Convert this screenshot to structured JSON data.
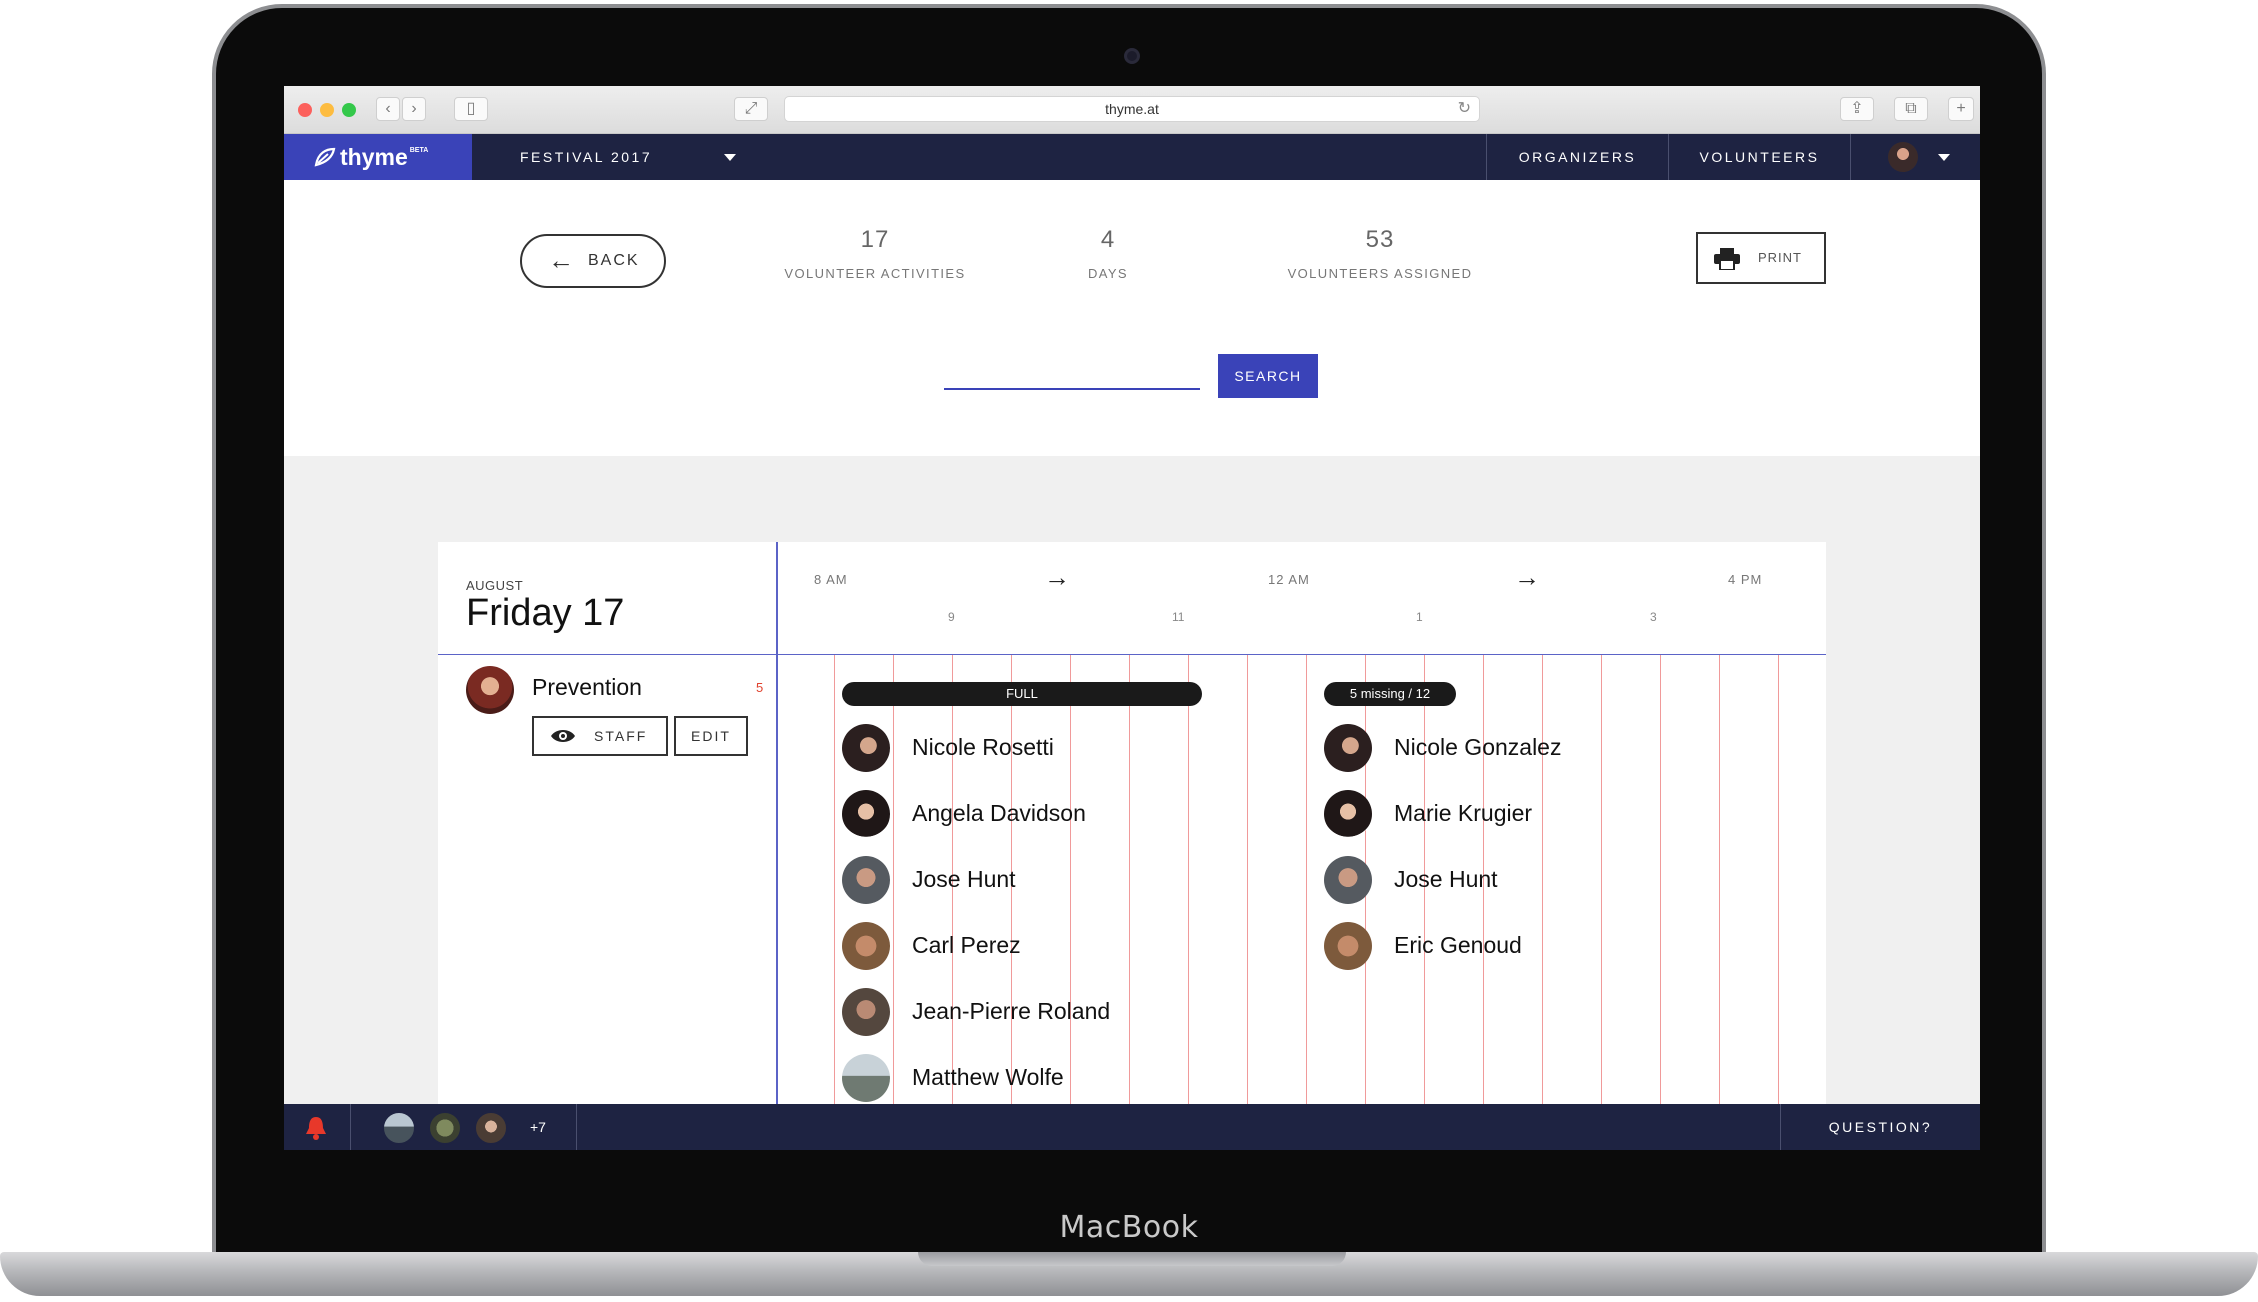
{
  "device": {
    "label": "MacBook"
  },
  "browser": {
    "url": "thyme.at"
  },
  "nav": {
    "brand": "thyme",
    "brand_badge": "BETA",
    "event": "FESTIVAL 2017",
    "links": [
      "ORGANIZERS",
      "VOLUNTEERS"
    ],
    "accent": "#3a43b8",
    "bar_color": "#1e2342"
  },
  "header": {
    "back_label": "BACK",
    "stats": [
      {
        "value": "17",
        "label": "VOLUNTEER ACTIVITIES"
      },
      {
        "value": "4",
        "label": "DAYS"
      },
      {
        "value": "53",
        "label": "VOLUNTEERS ASSIGNED"
      }
    ],
    "print_label": "PRINT"
  },
  "search": {
    "value": "",
    "placeholder": "",
    "button_label": "SEARCH"
  },
  "schedule": {
    "month": "AUGUST",
    "day": "Friday 17",
    "timeline": {
      "major_ticks": [
        "8 AM",
        "12 AM",
        "4 PM"
      ],
      "minor_ticks": [
        "9",
        "11",
        "1",
        "3"
      ]
    },
    "activity": {
      "name": "Prevention",
      "count": "5",
      "staff_label": "STAFF",
      "edit_label": "EDIT"
    },
    "shifts": [
      {
        "status": "FULL",
        "volunteers": [
          "Nicole Rosetti",
          "Angela Davidson",
          "Jose Hunt",
          "Carl Perez",
          "Jean-Pierre Roland",
          "Matthew Wolfe"
        ]
      },
      {
        "status": "5 missing / 12",
        "volunteers": [
          "Nicole Gonzalez",
          "Marie Krugier",
          "Jose Hunt",
          "Eric Genoud"
        ]
      }
    ]
  },
  "footer": {
    "more_count": "+7",
    "question_label": "QUESTION?"
  }
}
